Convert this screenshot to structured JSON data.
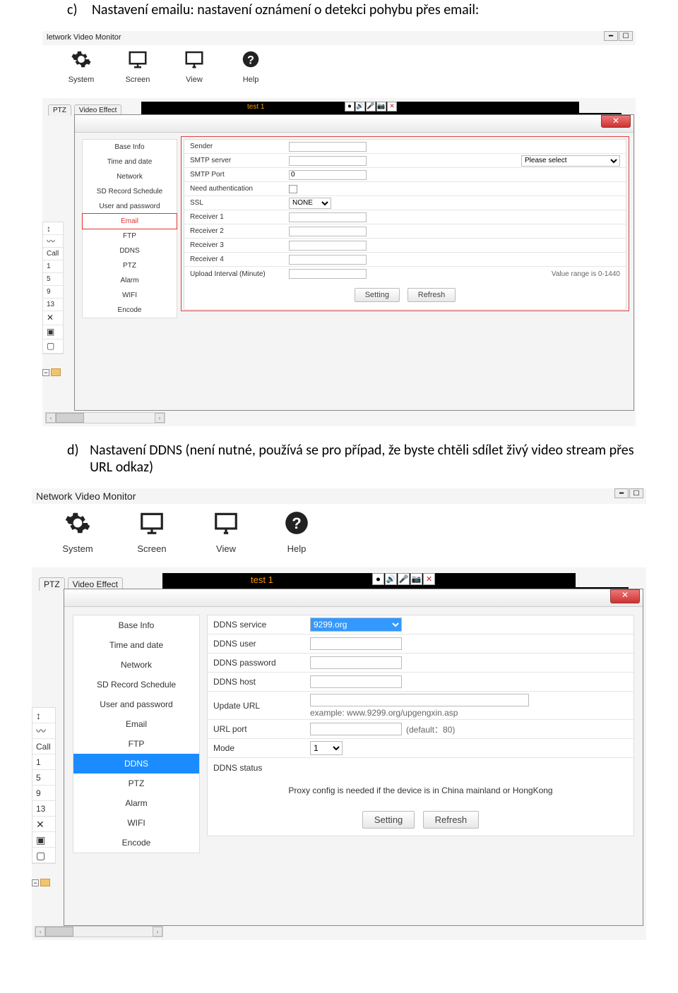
{
  "section_c": {
    "letter": "c)",
    "text": "Nastavení emailu: nastavení oznámení o detekci pohybu přes email:"
  },
  "section_d": {
    "letter": "d)",
    "text": "Nastavení DDNS (není nutné, používá se pro případ, že byste chtěli sdílet živý video stream přes URL odkaz)"
  },
  "shotA": {
    "app_title": "letwork Video Monitor",
    "toolbar": [
      "System",
      "Screen",
      "View",
      "Help"
    ],
    "ptz_tab": "PTZ",
    "ve_tab": "Video Effect",
    "camera_tab": "test 1",
    "sidebar": [
      "Base Info",
      "Time and date",
      "Network",
      "SD Record Schedule",
      "User and password",
      "Email",
      "FTP",
      "DDNS",
      "PTZ",
      "Alarm",
      "WIFI",
      "Encode"
    ],
    "sidebar_selected": "Email",
    "form": {
      "sender": "Sender",
      "smtp_server": "SMTP server",
      "smtp_please": "Please select",
      "smtp_port": "SMTP Port",
      "smtp_port_val": "0",
      "need_auth": "Need authentication",
      "ssl": "SSL",
      "ssl_val": "NONE",
      "recv1": "Receiver 1",
      "recv2": "Receiver 2",
      "recv3": "Receiver 3",
      "recv4": "Receiver 4",
      "upload": "Upload Interval (Minute)",
      "upload_hint": "Value range is 0-1440",
      "btn_setting": "Setting",
      "btn_refresh": "Refresh"
    },
    "leftcol": {
      "call": "Call",
      "p1": "1",
      "p5": "5",
      "p9": "9",
      "p13": "13"
    }
  },
  "shotB": {
    "app_title": "Network Video Monitor",
    "toolbar": [
      "System",
      "Screen",
      "View",
      "Help"
    ],
    "ptz_tab": "PTZ",
    "ve_tab": "Video Effect",
    "camera_tab": "test 1",
    "sidebar": [
      "Base Info",
      "Time and date",
      "Network",
      "SD Record Schedule",
      "User and password",
      "Email",
      "FTP",
      "DDNS",
      "PTZ",
      "Alarm",
      "WIFI",
      "Encode"
    ],
    "sidebar_selected": "DDNS",
    "form": {
      "service": "DDNS service",
      "service_val": "9299.org",
      "user": "DDNS user",
      "password": "DDNS password",
      "host": "DDNS host",
      "updateurl": "Update URL",
      "update_eg": "example: www.9299.org/upgengxin.asp",
      "urlport": "URL port",
      "urlport_hint": "(default：80)",
      "mode": "Mode",
      "mode_val": "1",
      "status": "DDNS status",
      "proxy_note": "Proxy config is needed if the device is in China mainland or HongKong",
      "btn_setting": "Setting",
      "btn_refresh": "Refresh"
    },
    "leftcol": {
      "call": "Call",
      "p1": "1",
      "p5": "5",
      "p9": "9",
      "p13": "13"
    }
  }
}
